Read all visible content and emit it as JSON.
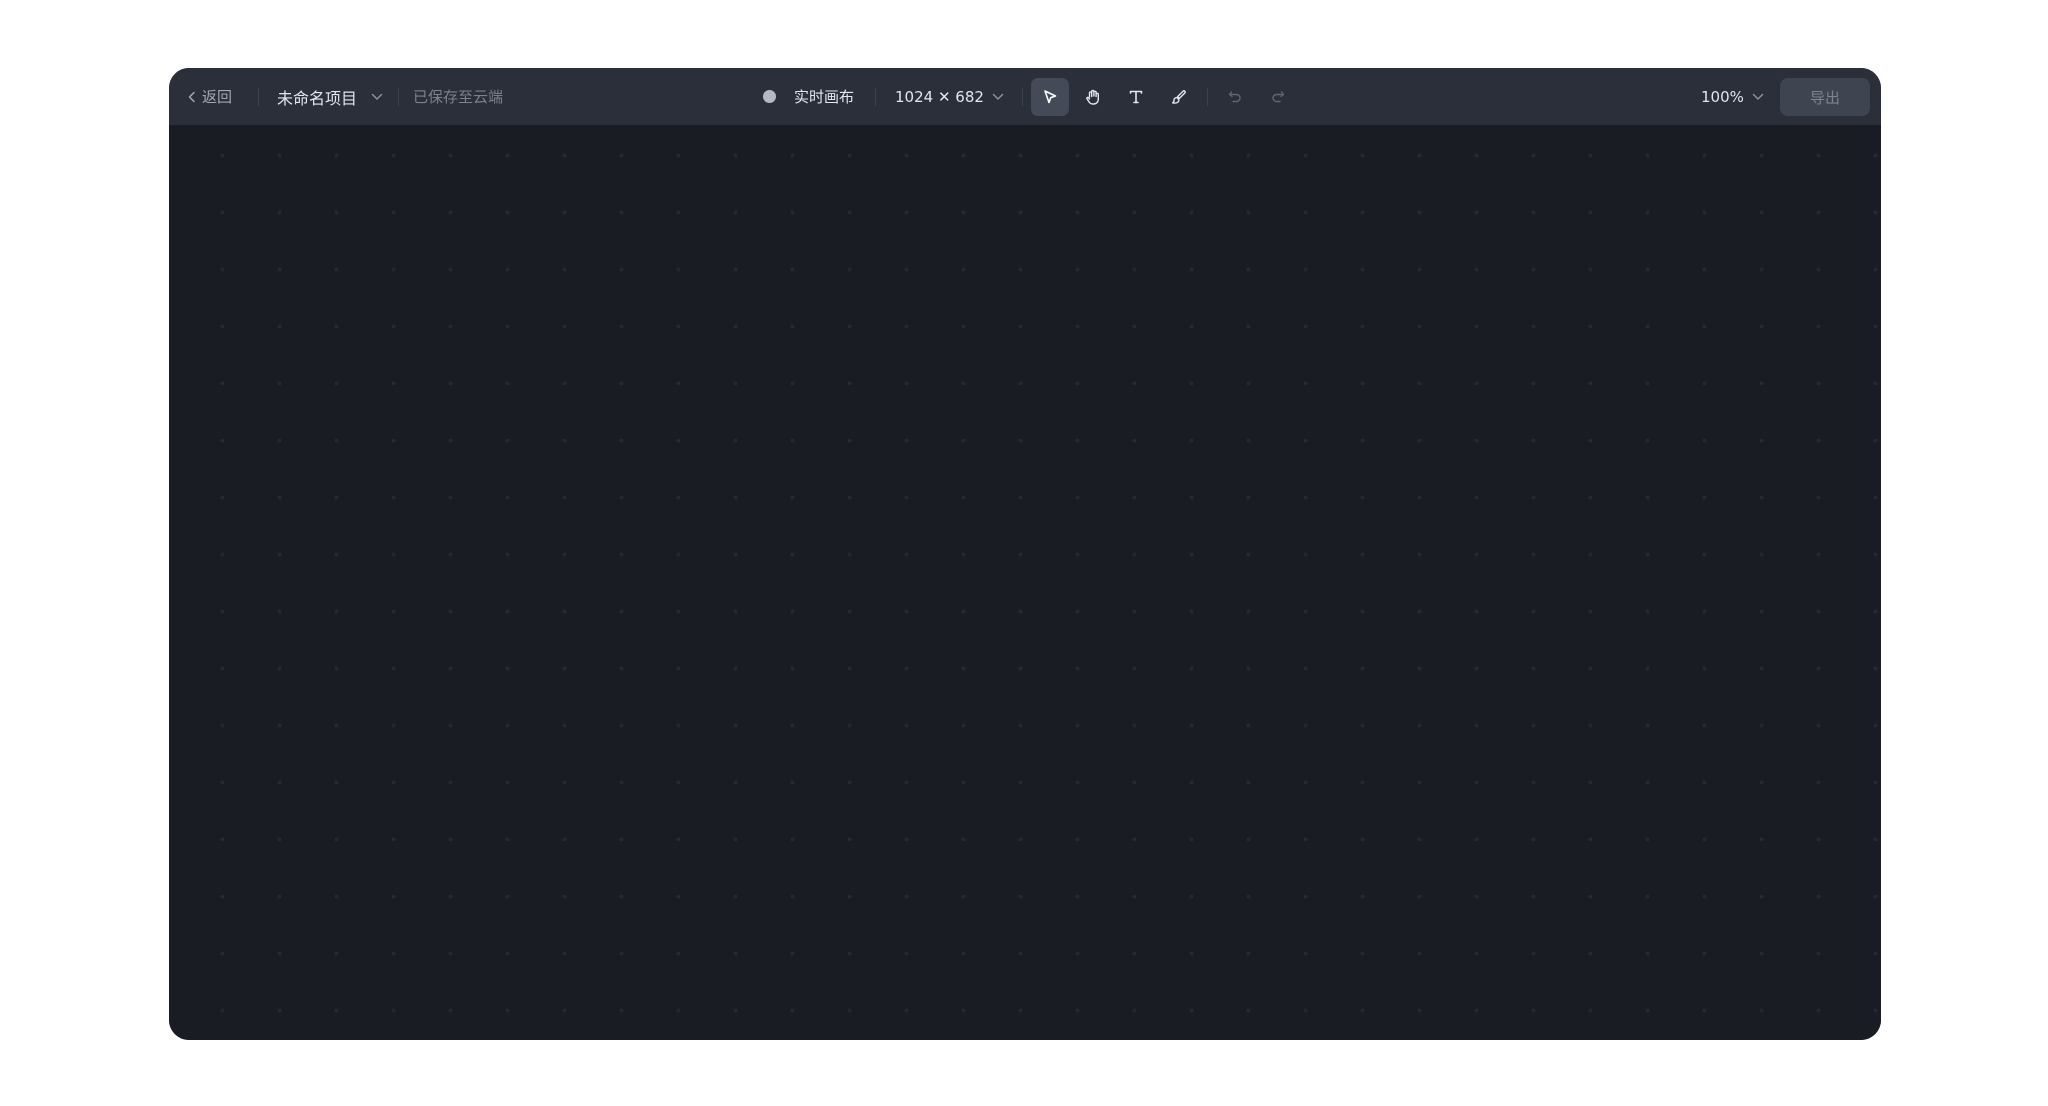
{
  "toolbar": {
    "back_label": "返回",
    "project_name": "未命名项目",
    "save_status": "已保存至云端",
    "canvas_mode": "实时画布",
    "canvas_size": "1024 ✕ 682",
    "zoom": "100%",
    "export_label": "导出"
  },
  "tools": [
    {
      "name": "select-tool",
      "icon": "cursor-arrow-icon",
      "active": true
    },
    {
      "name": "hand-tool",
      "icon": "hand-icon",
      "active": false
    },
    {
      "name": "text-tool",
      "icon": "text-t-icon",
      "active": false
    },
    {
      "name": "brush-tool",
      "icon": "brush-icon",
      "active": false
    },
    {
      "name": "undo-button",
      "icon": "undo-icon",
      "active": false
    },
    {
      "name": "redo-button",
      "icon": "redo-icon",
      "active": false
    }
  ],
  "colors": {
    "toolbar_bg": "#2b2f3a",
    "canvas_bg": "#1a1c24",
    "active_tool_bg": "#444a57",
    "export_bg": "#3f4451"
  }
}
